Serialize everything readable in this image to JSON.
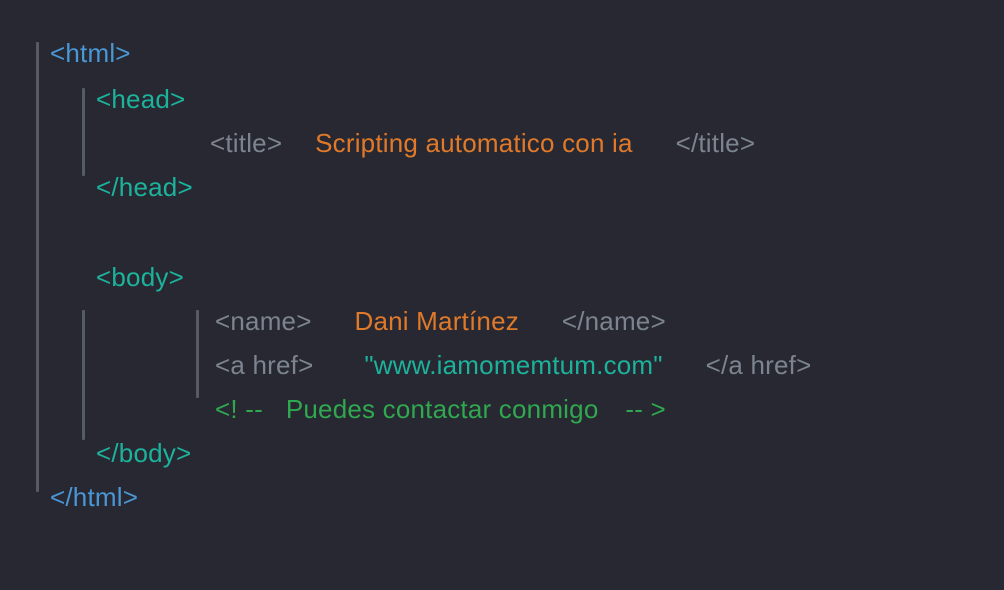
{
  "tags": {
    "html_open": "<html>",
    "html_close": "</html>",
    "head_open": "<head>",
    "head_close": "</head>",
    "body_open": "<body>",
    "body_close": "</body>",
    "title_open": "<title>",
    "title_close": "</title>",
    "name_open": "<name>",
    "name_close": "</name>",
    "a_open": "<a href>",
    "a_close": "</a href>",
    "comment_open": "<! --",
    "comment_close": "-- >"
  },
  "values": {
    "title": "Scripting automatico con ia",
    "name": "Dani Martínez",
    "href": "\"www.iamomemtum.com\"",
    "comment": "Puedes contactar conmigo"
  }
}
